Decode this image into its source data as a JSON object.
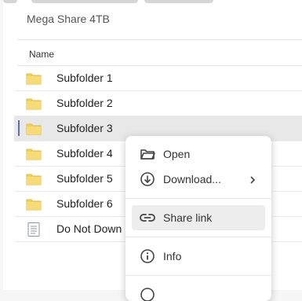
{
  "breadcrumb": "Mega Share 4TB",
  "columns": {
    "name": "Name"
  },
  "rows": [
    {
      "label": "Subfolder 1",
      "type": "folder"
    },
    {
      "label": "Subfolder 2",
      "type": "folder"
    },
    {
      "label": "Subfolder 3",
      "type": "folder",
      "selected": true
    },
    {
      "label": "Subfolder 4",
      "type": "folder"
    },
    {
      "label": "Subfolder 5",
      "type": "folder"
    },
    {
      "label": "Subfolder 6",
      "type": "folder"
    },
    {
      "label": "Do Not Down",
      "type": "document"
    }
  ],
  "context_menu": {
    "items": [
      {
        "label": "Open",
        "icon": "folder-open-icon"
      },
      {
        "label": "Download...",
        "icon": "download-icon",
        "submenu": true
      },
      {
        "label": "Share link",
        "icon": "link-icon",
        "highlighted": true
      },
      {
        "label": "Info",
        "icon": "info-icon"
      }
    ]
  },
  "colors": {
    "folder": "#f2cf5b",
    "folder_dark": "#e3b93f",
    "selection_bar": "#5b6fb3",
    "selected_row": "#e8e8e8"
  }
}
